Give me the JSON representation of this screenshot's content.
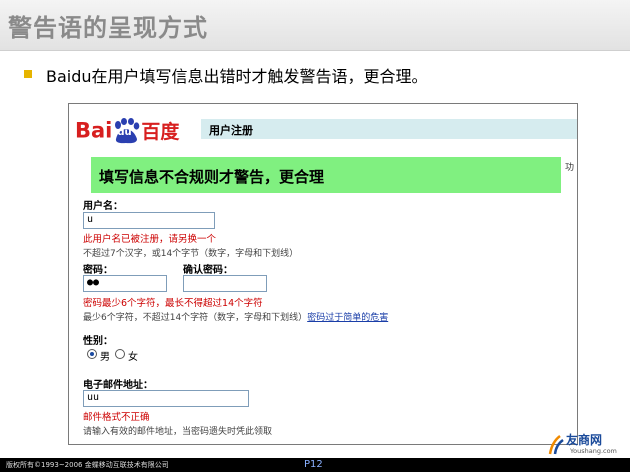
{
  "slide": {
    "title": "警告语的呈现方式",
    "bullet": "Baidu在用户填写信息出错时才触发警告语，更合理。",
    "page": "P12",
    "copyright": "版权所有©1993~2006  金蝶移动互联技术有限公司",
    "brand_name": "友商网",
    "brand_url": "Youshang.com"
  },
  "colors": {
    "accent_bullet": "#e6b400",
    "warning_highlight": "#80f080",
    "error_text": "#cc0000",
    "baidu_red": "#d71f1f",
    "baidu_blue": "#2a3fb0"
  },
  "form": {
    "logo_text": "Bai",
    "logo_du": "du",
    "logo_cn": "百度",
    "section_title": "用户注册",
    "warning_callout": "填写信息不合规则才警告，更合理",
    "cut_edge_text": "功",
    "username_label": "用户名：",
    "username_value": "u",
    "username_error": "此用户名已被注册，请另换一个",
    "username_hint": "不超过7个汉字，或14个字节（数字，字母和下划线）",
    "password_label": "密码：",
    "password_value": "●●",
    "confirm_password_label": "确认密码：",
    "confirm_password_value": "",
    "password_error": "密码最少6个字符，最长不得超过14个字符",
    "password_hint": "最少6个字符，不超过14个字符（数字，字母和下划线）",
    "password_link": "密码过于简单的危害",
    "gender_label": "性别：",
    "gender_male": "男",
    "gender_female": "女",
    "gender_selected": "男",
    "email_label": "电子邮件地址：",
    "email_value": "uu",
    "email_error": "邮件格式不正确",
    "email_hint": "请输入有效的邮件地址，当密码遗失时凭此领取"
  }
}
